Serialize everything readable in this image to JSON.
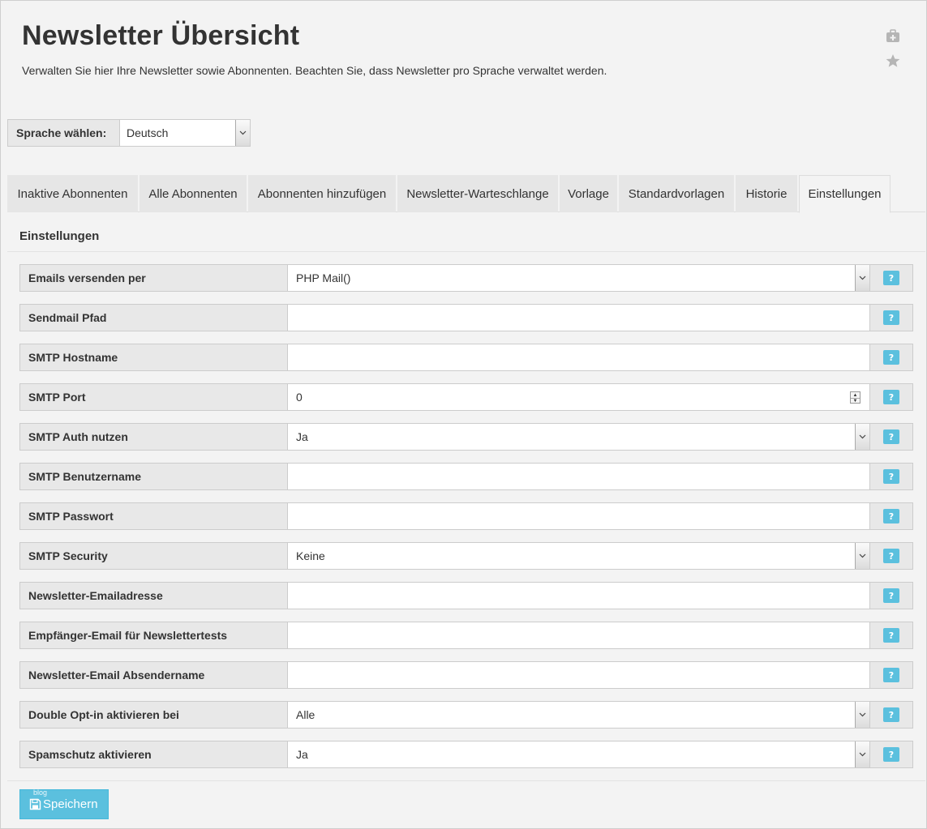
{
  "header": {
    "title": "Newsletter Übersicht",
    "description": "Verwalten Sie hier Ihre Newsletter sowie Abonnenten. Beachten Sie, dass Newsletter pro Sprache verwaltet werden.",
    "icons": [
      "medkit-icon",
      "star-icon"
    ]
  },
  "language": {
    "label": "Sprache wählen:",
    "value": "Deutsch"
  },
  "tabs": [
    {
      "label": "Inaktive Abonnenten"
    },
    {
      "label": "Alle Abonnenten"
    },
    {
      "label": "Abonnenten hinzufügen"
    },
    {
      "label": "Newsletter-Warteschlange"
    },
    {
      "label": "Vorlage"
    },
    {
      "label": "Standardvorlagen"
    },
    {
      "label": "Historie"
    },
    {
      "label": "Einstellungen",
      "active": true
    }
  ],
  "settings": {
    "title": "Einstellungen",
    "help_label": "?",
    "rows": [
      {
        "label": "Emails versenden per",
        "type": "select",
        "value": "PHP Mail()"
      },
      {
        "label": "Sendmail Pfad",
        "type": "text",
        "value": ""
      },
      {
        "label": "SMTP Hostname",
        "type": "text",
        "value": ""
      },
      {
        "label": "SMTP Port",
        "type": "number",
        "value": "0"
      },
      {
        "label": "SMTP Auth nutzen",
        "type": "select",
        "value": "Ja"
      },
      {
        "label": "SMTP Benutzername",
        "type": "text",
        "value": ""
      },
      {
        "label": "SMTP Passwort",
        "type": "text",
        "value": ""
      },
      {
        "label": "SMTP Security",
        "type": "select",
        "value": "Keine"
      },
      {
        "label": "Newsletter-Emailadresse",
        "type": "text",
        "value": ""
      },
      {
        "label": "Empfänger-Email für Newslettertests",
        "type": "text",
        "value": ""
      },
      {
        "label": "Newsletter-Email Absendername",
        "type": "text",
        "value": ""
      },
      {
        "label": "Double Opt-in aktivieren bei",
        "type": "select",
        "value": "Alle"
      },
      {
        "label": "Spamschutz aktivieren",
        "type": "select",
        "value": "Ja"
      }
    ]
  },
  "footer": {
    "save_label": "Speichern",
    "blog_tag": "blog",
    "save_icon": "floppy-disk-icon"
  },
  "colors": {
    "accent": "#5bc0de",
    "background": "#f3f3f3",
    "label_bg": "#e8e8e8"
  }
}
